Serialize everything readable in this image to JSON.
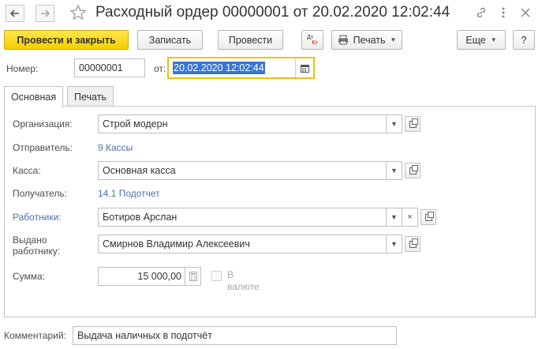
{
  "window": {
    "title": "Расходный ордер 00000001 от 20.02.2020 12:02:44",
    "back_icon": "arrow-left-icon",
    "forward_icon": "arrow-right-icon",
    "favorite_icon": "star-icon",
    "link_icon": "link-icon",
    "menu_icon": "more-vertical-icon",
    "close_icon": "close-icon"
  },
  "toolbar": {
    "post_and_close": "Провести и закрыть",
    "save": "Записать",
    "post": "Провести",
    "dt_kt_top": "Дт",
    "dt_kt_bottom": "Кт",
    "print": "Печать",
    "more": "Еще",
    "help": "?"
  },
  "header": {
    "number_label": "Номер:",
    "number_value": "00000001",
    "date_label": "от:",
    "date_value": "20.02.2020 12:02:44"
  },
  "tabs": [
    {
      "label": "Основная",
      "active": true
    },
    {
      "label": "Печать",
      "active": false
    }
  ],
  "form": {
    "organization_label": "Организация:",
    "organization_value": "Строй модерн",
    "sender_label": "Отправитель:",
    "sender_value": "9 Кассы",
    "cashbox_label": "Касса:",
    "cashbox_value": "Основная касса",
    "recipient_label": "Получатель:",
    "recipient_value": "14.1 Подотчет",
    "employees_label": "Работники:",
    "employees_value": "Ботиров Арслан",
    "issued_label_line1": "Выдано",
    "issued_label_line2": "работнику:",
    "issued_value": "Смирнов Владимир Алексеевич",
    "amount_label": "Сумма:",
    "amount_value": "15 000,00",
    "currency_label_line1": "В",
    "currency_label_line2": "валюте",
    "currency_checked": false
  },
  "comment": {
    "label": "Комментарий:",
    "value": "Выдача наличных в подотчёт"
  },
  "colors": {
    "primary_button": "#f5cf00",
    "link": "#4d6fa8",
    "focus_border": "#f2c200",
    "selection": "#3875d7"
  }
}
